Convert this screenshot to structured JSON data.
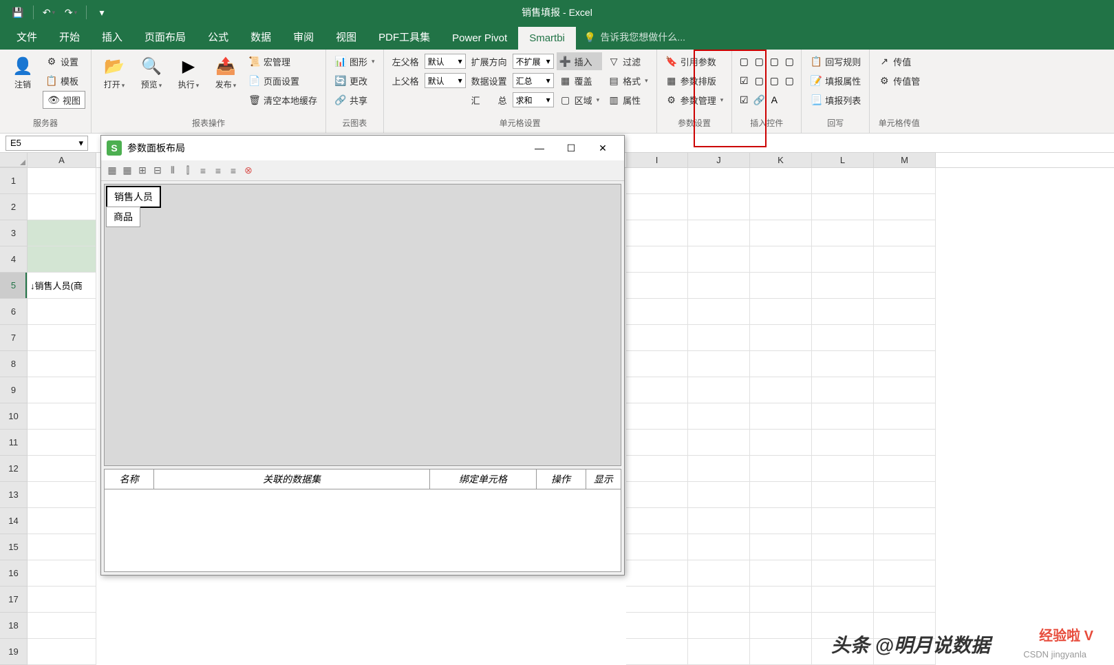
{
  "app_title": "销售填报 - Excel",
  "qat": {
    "save": "💾",
    "undo": "↶",
    "redo": "↷"
  },
  "tabs": [
    "文件",
    "开始",
    "插入",
    "页面布局",
    "公式",
    "数据",
    "审阅",
    "视图",
    "PDF工具集",
    "Power Pivot",
    "Smartbi"
  ],
  "active_tab": "Smartbi",
  "tell_me": "告诉我您想做什么...",
  "ribbon": {
    "group_server": "服务器",
    "logout": "注销",
    "settings": "设置",
    "template": "模板",
    "view": "视图",
    "group_report": "报表操作",
    "open": "打开",
    "preview": "预览",
    "execute": "执行",
    "publish": "发布",
    "macro_mgr": "宏管理",
    "page_setup": "页面设置",
    "clear_cache": "清空本地缓存",
    "group_cloud": "云图表",
    "chart": "图形",
    "change": "更改",
    "share": "共享",
    "group_cell": "单元格设置",
    "left_parent": "左父格",
    "top_parent": "上父格",
    "default": "默认",
    "expand_dir": "扩展方向",
    "no_expand": "不扩展",
    "data_setting": "数据设置",
    "summary": "汇总",
    "total": "汇　　总",
    "sum": "求和",
    "insert": "插入",
    "cover": "覆盖",
    "region": "区域",
    "filter": "过滤",
    "format": "格式",
    "property": "属性",
    "group_param": "参数设置",
    "ref_param": "引用参数",
    "param_layout": "参数排版",
    "param_mgr": "参数管理",
    "group_controls": "插入控件",
    "group_writeback": "回写",
    "wb_rules": "回写规则",
    "fill_attr": "填报属性",
    "fill_list": "填报列表",
    "group_propagate": "单元格传值",
    "propagate": "传值",
    "propagate_mgr": "传值管"
  },
  "name_box": "E5",
  "columns": [
    "A",
    "I",
    "J",
    "K",
    "L",
    "M"
  ],
  "rows": [
    "1",
    "2",
    "3",
    "4",
    "5",
    "6",
    "7",
    "8",
    "9",
    "10",
    "11",
    "12",
    "13",
    "14",
    "15",
    "16",
    "17",
    "18",
    "19"
  ],
  "cell_a5": "↓销售人员(商",
  "dialog": {
    "title": "参数面板布局",
    "param1": "销售人员",
    "param2": "商品",
    "col_name": "名称",
    "col_dataset": "关联的数据集",
    "col_bind": "绑定单元格",
    "col_action": "操作",
    "col_show": "显示"
  },
  "watermark1": "头条 @明月说数据",
  "watermark2": "CSDN jingyanla",
  "watermark3": "经验啦 V"
}
